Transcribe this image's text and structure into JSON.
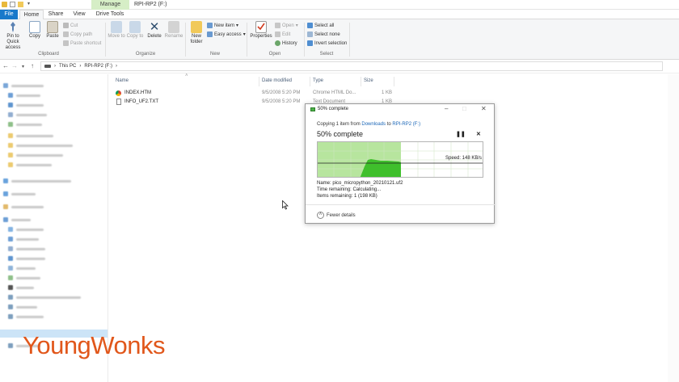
{
  "window": {
    "manage_tab": "Manage",
    "title": "RPI-RP2 (F:)"
  },
  "tabs": [
    {
      "label": "File"
    },
    {
      "label": "Home"
    },
    {
      "label": "Share"
    },
    {
      "label": "View"
    },
    {
      "label": "Drive Tools"
    }
  ],
  "ribbon": {
    "clipboard": {
      "pin": "Pin to Quick access",
      "copy": "Copy",
      "paste": "Paste",
      "cut": "Cut",
      "copy_path": "Copy path",
      "paste_shortcut": "Paste shortcut",
      "label": "Clipboard"
    },
    "organize": {
      "move_to": "Move to",
      "copy_to": "Copy to",
      "delete": "Delete",
      "rename": "Rename",
      "label": "Organize"
    },
    "new": {
      "new_folder": "New folder",
      "new_item": "New item",
      "easy_access": "Easy access",
      "label": "New"
    },
    "open": {
      "properties": "Properties",
      "open": "Open",
      "edit": "Edit",
      "history": "History",
      "label": "Open"
    },
    "select": {
      "select_all": "Select all",
      "select_none": "Select none",
      "invert_selection": "Invert selection",
      "label": "Select"
    }
  },
  "address": {
    "crumbs": [
      "This PC",
      "RPI-RP2 (F:)"
    ]
  },
  "columns": {
    "name": "Name",
    "date_modified": "Date modified",
    "type": "Type",
    "size": "Size"
  },
  "files": [
    {
      "name": "INDEX.HTM",
      "date": "9/5/2008 5:20 PM",
      "type": "Chrome HTML Do...",
      "size": "1 KB",
      "icon": "chrome-icon"
    },
    {
      "name": "INFO_UF2.TXT",
      "date": "9/5/2008 5:20 PM",
      "type": "Text Document",
      "size": "1 KB",
      "icon": "text-file-icon"
    }
  ],
  "dialog": {
    "title": "50% complete",
    "copy_prefix": "Copying 1 item from",
    "source": "Downloads",
    "to_word": "to",
    "destination": "RPI-RP2 (F:)",
    "percent_text": "50% complete",
    "progress": 0.5,
    "speed": "Speed: 148 KB/s",
    "name": "Name:  pico_micropython_20210121.uf2",
    "time_remaining": "Time remaining:  Calculating...",
    "items_remaining": "Items remaining:  1 (198 KB)",
    "fewer_details": "Fewer details",
    "colors": {
      "fill": "#b7e59e",
      "graph": "#3fbf2c",
      "bar": "#06b025"
    }
  },
  "watermark": "YoungWonks"
}
